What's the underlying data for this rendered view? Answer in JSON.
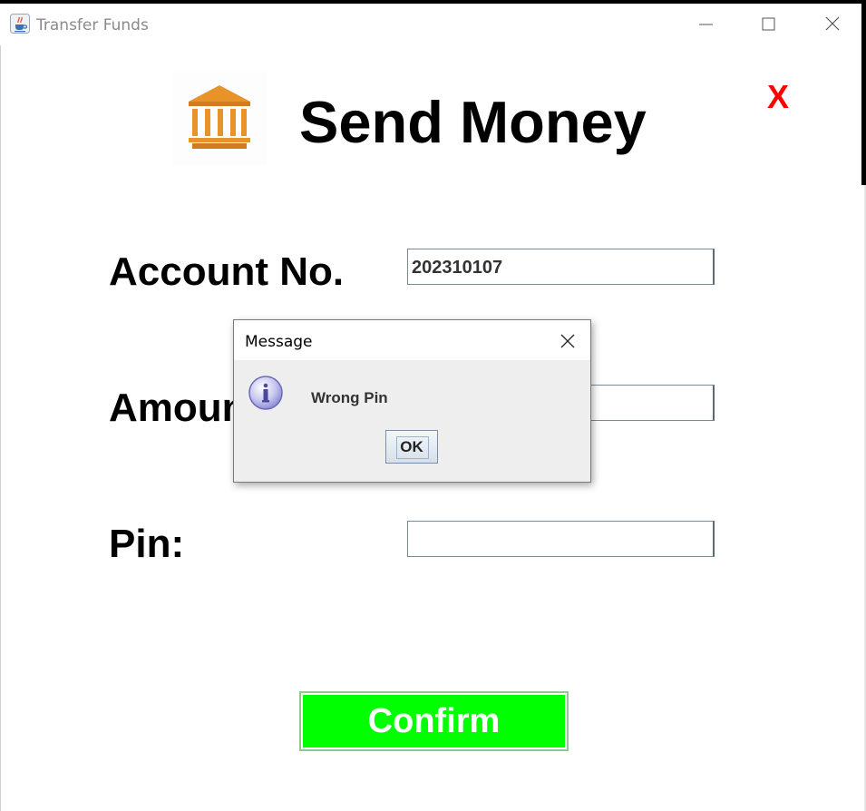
{
  "window": {
    "title": "Transfer Funds",
    "icon": "java-cup-icon",
    "controls": [
      "minimize-icon",
      "maximize-icon",
      "close-icon"
    ]
  },
  "header": {
    "icon": "bank-icon",
    "title": "Send Money",
    "close_label": "X"
  },
  "form": {
    "account": {
      "label": "Account No.",
      "value": "202310107"
    },
    "amount": {
      "label": "Amount:",
      "value": ""
    },
    "pin": {
      "label": "Pin:",
      "value": ""
    }
  },
  "confirm_button": {
    "label": "Confirm"
  },
  "dialog": {
    "title": "Message",
    "icon": "info-icon",
    "message": "Wrong Pin",
    "ok_label": "OK"
  },
  "colors": {
    "confirm_bg": "#00ff00",
    "close_x": "#ff0000",
    "bank_icon": "#e8922a"
  }
}
